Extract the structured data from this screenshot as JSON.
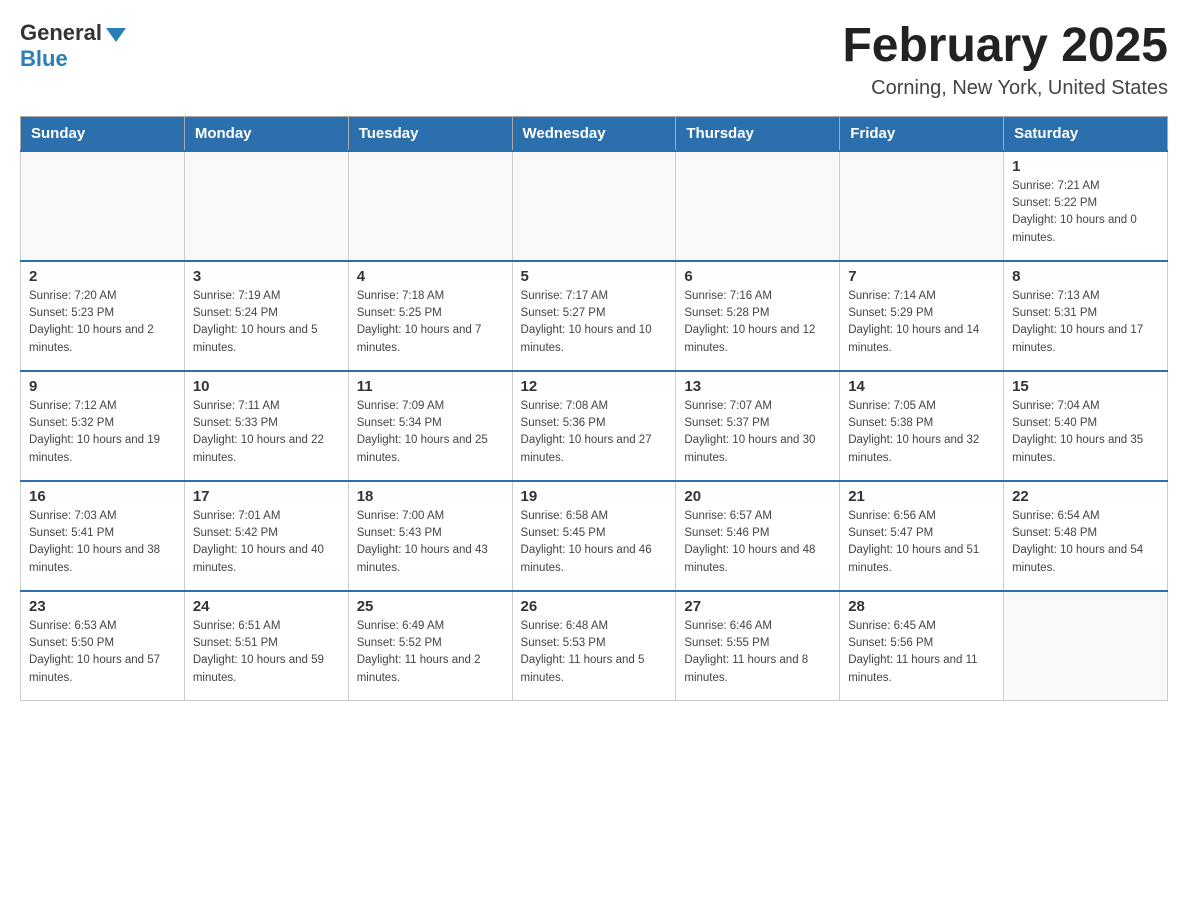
{
  "header": {
    "logo_general": "General",
    "logo_blue": "Blue",
    "title": "February 2025",
    "subtitle": "Corning, New York, United States"
  },
  "weekdays": [
    "Sunday",
    "Monday",
    "Tuesday",
    "Wednesday",
    "Thursday",
    "Friday",
    "Saturday"
  ],
  "weeks": [
    [
      {
        "day": "",
        "info": ""
      },
      {
        "day": "",
        "info": ""
      },
      {
        "day": "",
        "info": ""
      },
      {
        "day": "",
        "info": ""
      },
      {
        "day": "",
        "info": ""
      },
      {
        "day": "",
        "info": ""
      },
      {
        "day": "1",
        "info": "Sunrise: 7:21 AM\nSunset: 5:22 PM\nDaylight: 10 hours and 0 minutes."
      }
    ],
    [
      {
        "day": "2",
        "info": "Sunrise: 7:20 AM\nSunset: 5:23 PM\nDaylight: 10 hours and 2 minutes."
      },
      {
        "day": "3",
        "info": "Sunrise: 7:19 AM\nSunset: 5:24 PM\nDaylight: 10 hours and 5 minutes."
      },
      {
        "day": "4",
        "info": "Sunrise: 7:18 AM\nSunset: 5:25 PM\nDaylight: 10 hours and 7 minutes."
      },
      {
        "day": "5",
        "info": "Sunrise: 7:17 AM\nSunset: 5:27 PM\nDaylight: 10 hours and 10 minutes."
      },
      {
        "day": "6",
        "info": "Sunrise: 7:16 AM\nSunset: 5:28 PM\nDaylight: 10 hours and 12 minutes."
      },
      {
        "day": "7",
        "info": "Sunrise: 7:14 AM\nSunset: 5:29 PM\nDaylight: 10 hours and 14 minutes."
      },
      {
        "day": "8",
        "info": "Sunrise: 7:13 AM\nSunset: 5:31 PM\nDaylight: 10 hours and 17 minutes."
      }
    ],
    [
      {
        "day": "9",
        "info": "Sunrise: 7:12 AM\nSunset: 5:32 PM\nDaylight: 10 hours and 19 minutes."
      },
      {
        "day": "10",
        "info": "Sunrise: 7:11 AM\nSunset: 5:33 PM\nDaylight: 10 hours and 22 minutes."
      },
      {
        "day": "11",
        "info": "Sunrise: 7:09 AM\nSunset: 5:34 PM\nDaylight: 10 hours and 25 minutes."
      },
      {
        "day": "12",
        "info": "Sunrise: 7:08 AM\nSunset: 5:36 PM\nDaylight: 10 hours and 27 minutes."
      },
      {
        "day": "13",
        "info": "Sunrise: 7:07 AM\nSunset: 5:37 PM\nDaylight: 10 hours and 30 minutes."
      },
      {
        "day": "14",
        "info": "Sunrise: 7:05 AM\nSunset: 5:38 PM\nDaylight: 10 hours and 32 minutes."
      },
      {
        "day": "15",
        "info": "Sunrise: 7:04 AM\nSunset: 5:40 PM\nDaylight: 10 hours and 35 minutes."
      }
    ],
    [
      {
        "day": "16",
        "info": "Sunrise: 7:03 AM\nSunset: 5:41 PM\nDaylight: 10 hours and 38 minutes."
      },
      {
        "day": "17",
        "info": "Sunrise: 7:01 AM\nSunset: 5:42 PM\nDaylight: 10 hours and 40 minutes."
      },
      {
        "day": "18",
        "info": "Sunrise: 7:00 AM\nSunset: 5:43 PM\nDaylight: 10 hours and 43 minutes."
      },
      {
        "day": "19",
        "info": "Sunrise: 6:58 AM\nSunset: 5:45 PM\nDaylight: 10 hours and 46 minutes."
      },
      {
        "day": "20",
        "info": "Sunrise: 6:57 AM\nSunset: 5:46 PM\nDaylight: 10 hours and 48 minutes."
      },
      {
        "day": "21",
        "info": "Sunrise: 6:56 AM\nSunset: 5:47 PM\nDaylight: 10 hours and 51 minutes."
      },
      {
        "day": "22",
        "info": "Sunrise: 6:54 AM\nSunset: 5:48 PM\nDaylight: 10 hours and 54 minutes."
      }
    ],
    [
      {
        "day": "23",
        "info": "Sunrise: 6:53 AM\nSunset: 5:50 PM\nDaylight: 10 hours and 57 minutes."
      },
      {
        "day": "24",
        "info": "Sunrise: 6:51 AM\nSunset: 5:51 PM\nDaylight: 10 hours and 59 minutes."
      },
      {
        "day": "25",
        "info": "Sunrise: 6:49 AM\nSunset: 5:52 PM\nDaylight: 11 hours and 2 minutes."
      },
      {
        "day": "26",
        "info": "Sunrise: 6:48 AM\nSunset: 5:53 PM\nDaylight: 11 hours and 5 minutes."
      },
      {
        "day": "27",
        "info": "Sunrise: 6:46 AM\nSunset: 5:55 PM\nDaylight: 11 hours and 8 minutes."
      },
      {
        "day": "28",
        "info": "Sunrise: 6:45 AM\nSunset: 5:56 PM\nDaylight: 11 hours and 11 minutes."
      },
      {
        "day": "",
        "info": ""
      }
    ]
  ]
}
